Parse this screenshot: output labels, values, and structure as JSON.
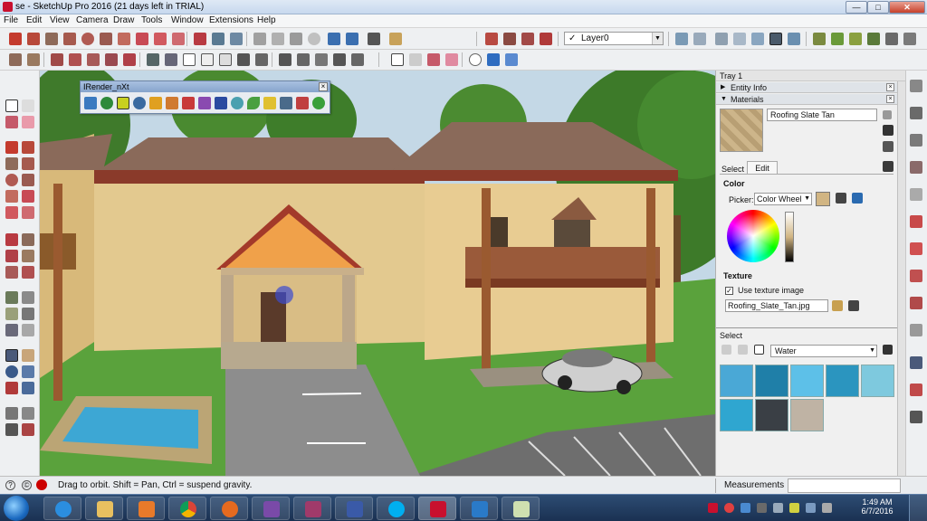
{
  "window": {
    "title": "se - SketchUp Pro 2016 (21 days left in TRIAL)",
    "minimize_label": "—",
    "maximize_label": "□",
    "close_label": "✕"
  },
  "menu": {
    "items": [
      "File",
      "Edit",
      "View",
      "Camera",
      "Draw",
      "Tools",
      "Window",
      "Extensions",
      "Help"
    ]
  },
  "layer": {
    "value": "Layer0",
    "check": "✓"
  },
  "irender": {
    "title": "IRender_nXt",
    "close_label": "×"
  },
  "tray": {
    "title": "Tray 1",
    "close_label": "×",
    "panels": {
      "entity_info": "Entity Info",
      "materials": "Materials"
    },
    "material_name": "Roofing Slate Tan",
    "tabs": {
      "select": "Select",
      "edit": "Edit"
    },
    "color_label": "Color",
    "picker_label": "Picker:",
    "picker_value": "Color Wheel",
    "texture_label": "Texture",
    "use_texture_label": "Use texture image",
    "texture_file": "Roofing_Slate_Tan.jpg",
    "select_label": "Select",
    "collection": "Water"
  },
  "status": {
    "hint": "Drag to orbit.  Shift = Pan, Ctrl = suspend gravity.",
    "measurements_label": "Measurements"
  },
  "taskbar": {
    "time": "1:49 AM",
    "date": "6/7/2016"
  },
  "colors": {
    "sky": "#c4d8e6",
    "wall": "#e3c98f",
    "roof": "#8a6a5a",
    "grass": "#5aa23c",
    "road": "#8d8d8d",
    "water_swatches": [
      "#4aa8d6",
      "#1f7fa8",
      "#5dc0e8",
      "#2b95bf",
      "#7ec9de",
      "#2fa6d0",
      "#3a3f45",
      "#bfb3a4"
    ]
  }
}
